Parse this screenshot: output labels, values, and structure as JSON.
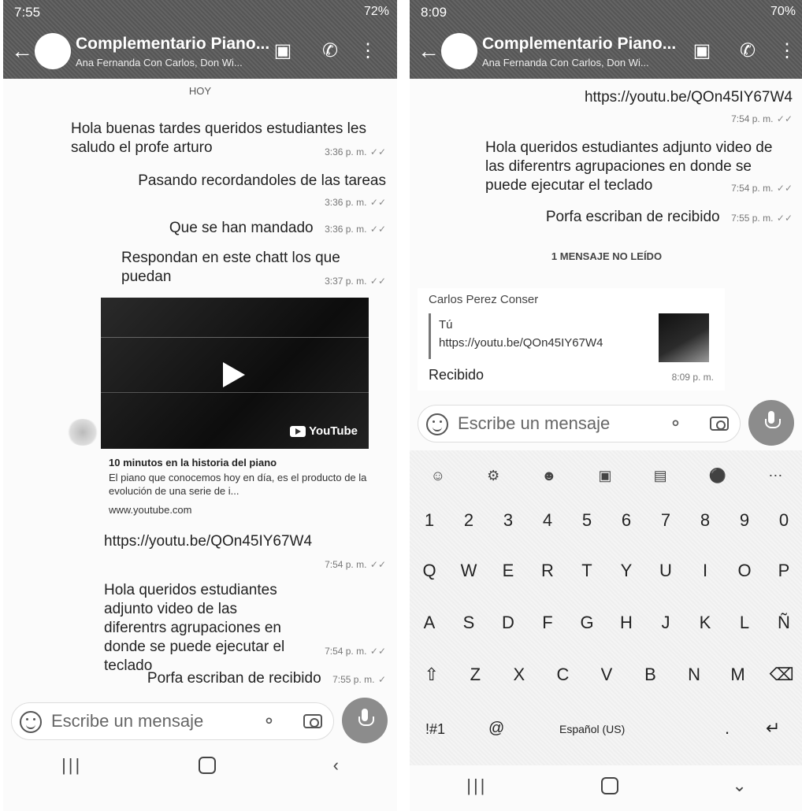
{
  "left": {
    "status": {
      "time": "7:55",
      "battery": "72%"
    },
    "header": {
      "title": "Complementario Piano...",
      "subtitle": "Ana Fernanda Con Carlos, Don Wi..."
    },
    "day_chip": "HOY",
    "messages": [
      {
        "text": "Hola buenas tardes queridos estudiantes les saludo el profe arturo",
        "time": "3:36 p. m."
      },
      {
        "text": "Pasando recordandoles de las tareas",
        "time": "3:36 p. m."
      },
      {
        "text": "Que se han mandado",
        "time": "3:36 p. m."
      },
      {
        "text": "Respondan en este chatt los que puedan",
        "time": "3:37 p. m."
      },
      {
        "text": "https://youtu.be/QOn45IY67W4",
        "time": "7:54 p. m."
      },
      {
        "text": "Hola queridos estudiantes adjunto video de las diferentrs agrupaciones en donde se puede ejecutar el teclado",
        "time": "7:54 p. m."
      },
      {
        "text": "Porfa escriban de recibido",
        "time": "7:55 p. m."
      }
    ],
    "link_preview": {
      "yt_label": "YouTube",
      "title": "10 minutos en la historia del piano",
      "description": "El piano que conocemos hoy en día, es el producto de la evolución de una serie de i...",
      "domain": "www.youtube.com"
    },
    "input_placeholder": "Escribe un mensaje"
  },
  "right": {
    "status": {
      "time": "8:09",
      "battery": "70%"
    },
    "header": {
      "title": "Complementario Piano...",
      "subtitle": "Ana Fernanda Con Carlos, Don Wi..."
    },
    "messages": [
      {
        "text": "https://youtu.be/QOn45IY67W4",
        "time": "7:54 p. m."
      },
      {
        "text": "Hola queridos estudiantes adjunto video de las diferentrs agrupaciones en donde se puede ejecutar el teclado",
        "time": "7:54 p. m."
      },
      {
        "text": "Porfa escriban de recibido",
        "time": "7:55 p. m."
      }
    ],
    "unread_label": "1 MENSAJE NO LEÍDO",
    "reply": {
      "sender": "Carlos Perez Conser",
      "quoted_who": "Tú",
      "quoted_url": "https://youtu.be/QOn45IY67W4",
      "text": "Recibido",
      "time": "8:09 p. m."
    },
    "input_placeholder": "Escribe un mensaje",
    "keyboard": {
      "numbers": [
        "1",
        "2",
        "3",
        "4",
        "5",
        "6",
        "7",
        "8",
        "9",
        "0"
      ],
      "row1": [
        "Q",
        "W",
        "E",
        "R",
        "T",
        "Y",
        "U",
        "I",
        "O",
        "P"
      ],
      "row2": [
        "A",
        "S",
        "D",
        "F",
        "G",
        "H",
        "J",
        "K",
        "L",
        "Ñ"
      ],
      "row3": [
        "Z",
        "X",
        "C",
        "V",
        "B",
        "N",
        "M"
      ],
      "symbols": "!#1",
      "at": "@",
      "space_label": "Español (US)",
      "period": "."
    }
  },
  "icons": {
    "back": "arrow-left-icon",
    "video_call": "video-camera-icon",
    "call": "phone-icon",
    "menu": "more-vertical-icon",
    "emoji": "smiley-icon",
    "attach": "paperclip-icon",
    "camera": "camera-icon",
    "mic": "microphone-icon"
  }
}
